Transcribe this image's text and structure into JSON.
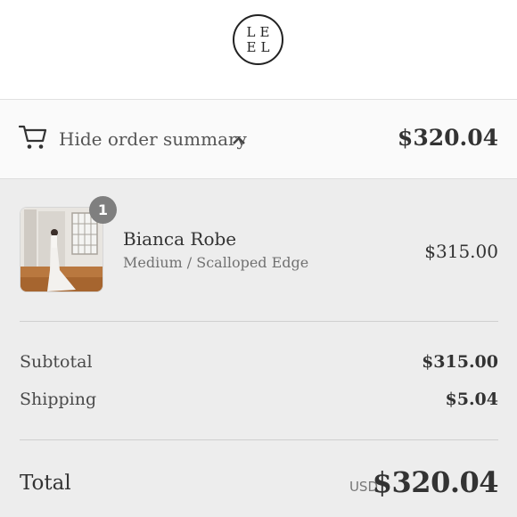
{
  "brand": {
    "logo_line1": "LE",
    "logo_line2": "EL"
  },
  "summary_toggle": {
    "icon": "cart-icon",
    "label": "Hide order summary",
    "chevron": "chevron-up-icon",
    "total": "$320.04"
  },
  "line_items": [
    {
      "quantity": "1",
      "name": "Bianca Robe",
      "variant": "Medium / Scalloped Edge",
      "price": "$315.00"
    }
  ],
  "totals": {
    "subtotal_label": "Subtotal",
    "subtotal_value": "$315.00",
    "shipping_label": "Shipping",
    "shipping_value": "$5.04",
    "total_label": "Total",
    "currency": "USD",
    "total_value": "$320.04"
  },
  "colors": {
    "summary_background": "#ededed",
    "toggle_background": "#fafafa",
    "badge": "#7f7f7f",
    "text": "#333333"
  }
}
